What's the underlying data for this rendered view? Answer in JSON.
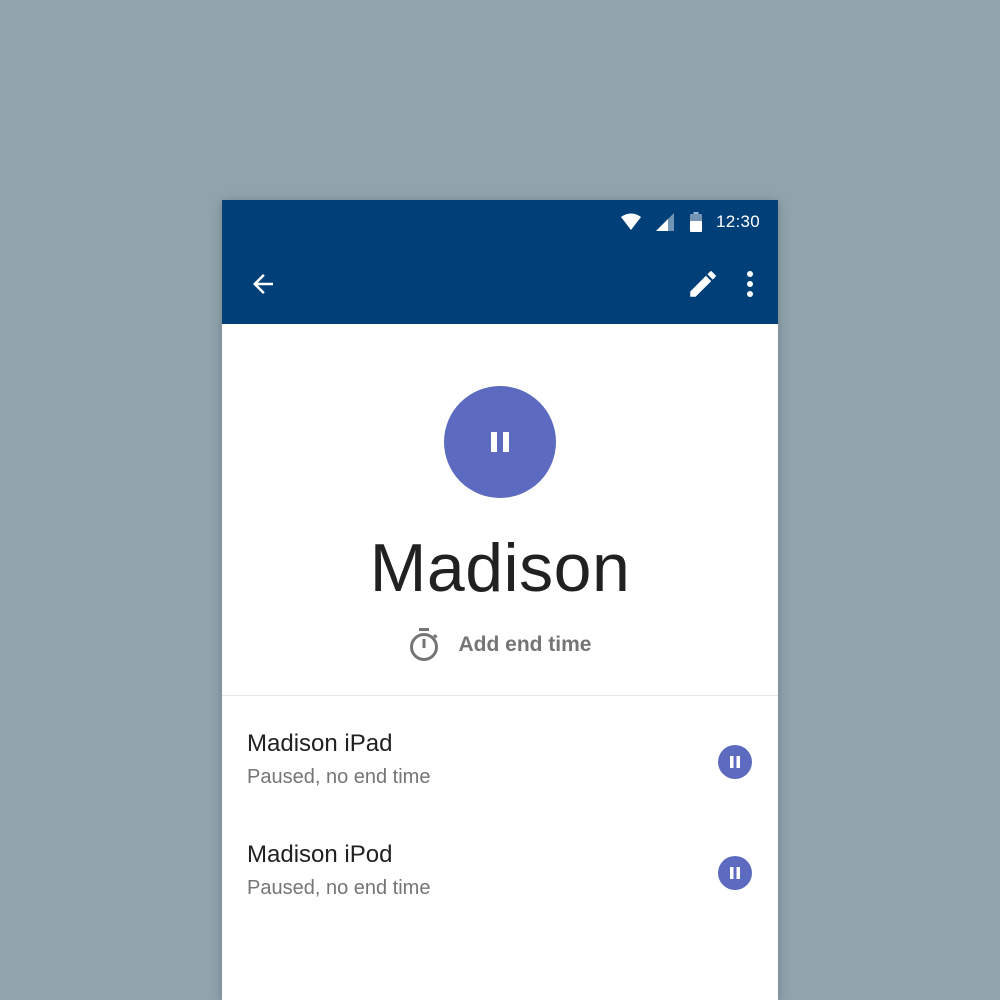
{
  "status_bar": {
    "time": "12:30",
    "icons": [
      "wifi-icon",
      "signal-icon",
      "battery-icon"
    ]
  },
  "app_bar": {
    "icons": [
      "back-arrow-icon",
      "edit-pencil-icon",
      "more-vert-icon"
    ]
  },
  "profile": {
    "name": "Madison",
    "state_icon": "pause-icon",
    "end_time_icon": "timer-icon",
    "end_time_label": "Add end time"
  },
  "devices": [
    {
      "name": "Madison iPad",
      "status": "Paused, no end time",
      "icon": "pause-icon"
    },
    {
      "name": "Madison iPod",
      "status": "Paused, no end time",
      "icon": "pause-icon"
    }
  ],
  "colors": {
    "background": "#90a4ae",
    "app_bar": "#003f78",
    "accent": "#5c6bc0",
    "primary_text": "#212121",
    "secondary_text": "#757575"
  }
}
